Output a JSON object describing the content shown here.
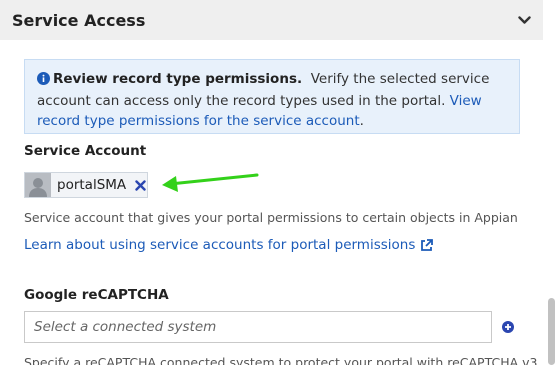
{
  "section": {
    "title": "Service Access",
    "toggle_icon": "chevron-down-icon"
  },
  "info": {
    "icon": "info-circle-icon",
    "bold": "Review record type permissions.",
    "text": "Verify the selected service account can access only the record types used in the portal.",
    "link": "View record type permissions for the service account",
    "after_link": "."
  },
  "service_account": {
    "label": "Service Account",
    "chip_value": "portalSMA",
    "remove_icon": "close-icon",
    "help": "Service account that gives your portal permissions to certain objects in Appian",
    "learn_link": "Learn about using service accounts for portal permissions",
    "learn_icon": "external-link-icon"
  },
  "recaptcha": {
    "label": "Google reCAPTCHA",
    "placeholder": "Select a connected system",
    "add_icon": "plus-circle-icon",
    "help": "Specify a reCAPTCHA connected system to protect your portal with reCAPTCHA v3"
  },
  "colors": {
    "accent": "#1c5bb8",
    "info_bg": "#e8f1fb",
    "arrow": "#33d11a"
  }
}
